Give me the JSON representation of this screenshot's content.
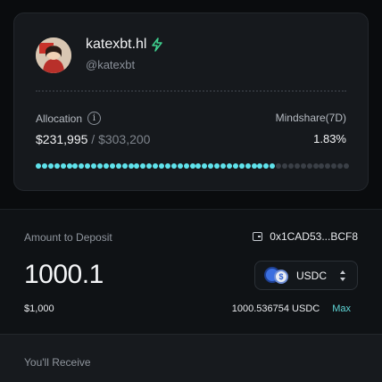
{
  "profile": {
    "name": "katexbt.hl",
    "handle": "@katexbt",
    "verified_icon": "bolt-icon",
    "allocation_label": "Allocation",
    "allocation_value": "$231,995",
    "allocation_separator": "/",
    "allocation_total": "$303,200",
    "mindshare_label": "Mindshare(7D)",
    "mindshare_value": "1.83%",
    "allocation_progress": 0.765,
    "colors": {
      "filled_dot": "#5fe3ec",
      "empty_dot": "#3a3f46",
      "bolt": "#3fcf8e"
    }
  },
  "deposit": {
    "label": "Amount to Deposit",
    "wallet_icon": "wallet-icon",
    "wallet_address": "0x1CAD53...BCF8",
    "amount": "1000.1",
    "token": "USDC",
    "usd_value": "$1,000",
    "balance": "1000.536754 USDC",
    "max_label": "Max",
    "accent": "#5fd6d6"
  },
  "receive": {
    "label": "You'll Receive"
  }
}
